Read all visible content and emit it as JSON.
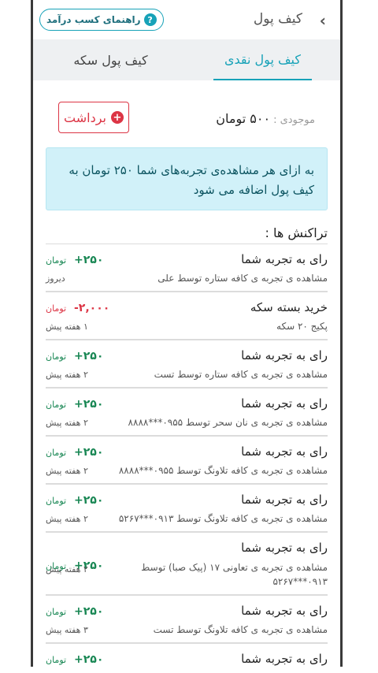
{
  "header": {
    "title": "کیف پول",
    "guide_label": "راهنمای کسب درآمد",
    "guide_icon": "?"
  },
  "tabs": [
    {
      "label": "کیف پول نقدی",
      "active": true
    },
    {
      "label": "کیف پول سکه",
      "active": false
    }
  ],
  "balance": {
    "label": "موجودی :",
    "value": "۵۰۰ تومان"
  },
  "withdraw": {
    "label": "برداشت",
    "icon": "+"
  },
  "info": {
    "text": "به ازای هر مشاهده‌ی تجربه‌های شما ۲۵۰ تومان به کیف پول اضافه می شود"
  },
  "transactions_title": "تراکنش ها :",
  "transactions": [
    {
      "title": "رای به تجربه شما",
      "desc": "مشاهده ی تجربه ی کافه ستاره توسط علی",
      "amount": "+۲۵۰",
      "unit": "تومان",
      "time": "دیروز",
      "type": "pos"
    },
    {
      "title": "خرید بسته سکه",
      "desc": "پکیج ۲۰ سکه",
      "amount": "-۲,۰۰۰",
      "unit": "تومان",
      "time": "۱ هفته پیش",
      "type": "neg"
    },
    {
      "title": "رای به تجربه شما",
      "desc": "مشاهده ی تجربه ی کافه ستاره توسط تست",
      "amount": "+۲۵۰",
      "unit": "تومان",
      "time": "۲ هفته پیش",
      "type": "pos"
    },
    {
      "title": "رای به تجربه شما",
      "desc": "مشاهده ی تجربه ی نان سحر توسط ۰۹۵۵***۸۸۸۸",
      "amount": "+۲۵۰",
      "unit": "تومان",
      "time": "۲ هفته پیش",
      "type": "pos"
    },
    {
      "title": "رای به تجربه شما",
      "desc": "مشاهده ی تجربه ی کافه تلاونگ توسط ۰۹۵۵***۸۸۸۸",
      "amount": "+۲۵۰",
      "unit": "تومان",
      "time": "۲ هفته پیش",
      "type": "pos"
    },
    {
      "title": "رای به تجربه شما",
      "desc": "مشاهده ی تجربه ی کافه تلاونگ توسط ۰۹۱۳***۵۲۶۷",
      "amount": "+۲۵۰",
      "unit": "تومان",
      "time": "۲ هفته پیش",
      "type": "pos"
    },
    {
      "title": "رای به تجربه شما",
      "desc": "مشاهده ی تجربه ی تعاونی ۱۷ (پیک صبا) توسط ۰۹۱۳***۵۲۶۷",
      "amount": "+۲۵۰",
      "unit": "تومان",
      "time": "۲ هفته پیش",
      "type": "pos"
    },
    {
      "title": "رای به تجربه شما",
      "desc": "مشاهده ی تجربه ی کافه تلاونگ توسط تست",
      "amount": "+۲۵۰",
      "unit": "تومان",
      "time": "۳ هفته پیش",
      "type": "pos"
    },
    {
      "title": "رای به تجربه شما",
      "desc": "",
      "amount": "+۲۵۰",
      "unit": "تومان",
      "time": "",
      "type": "pos"
    }
  ]
}
